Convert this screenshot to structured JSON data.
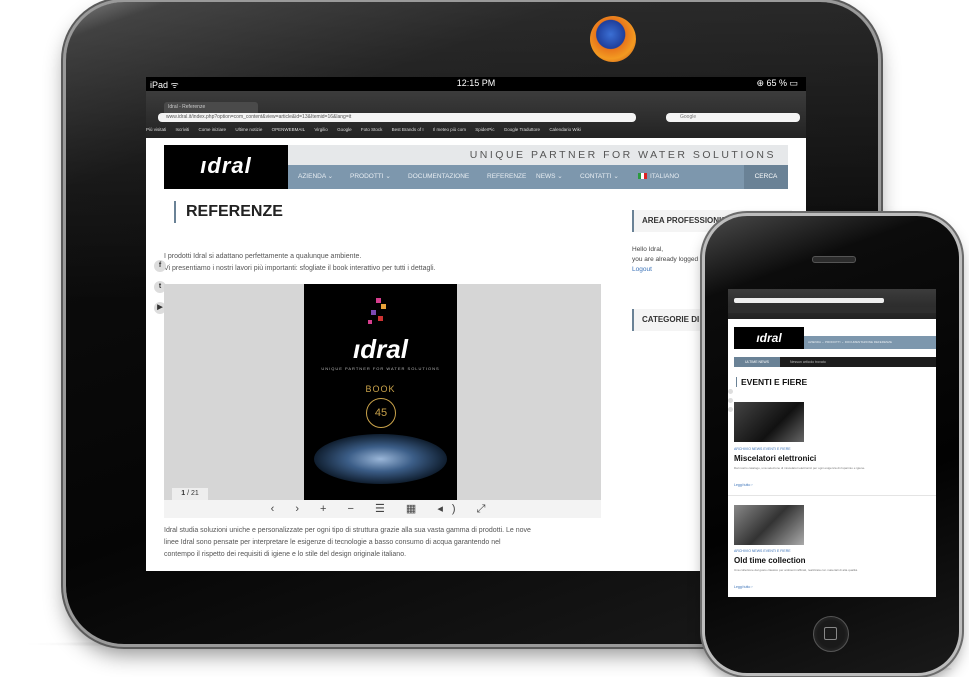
{
  "ipad": {
    "status_left": "iPad  ᯤ",
    "status_time": "12:15 PM",
    "status_battery": "⊕ 65 % ▭",
    "browser": {
      "tab_label": "Idral - Referenze",
      "url": "www.idral.it/index.php?option=com_content&view=article&id=13&Itemid=16&lang=it",
      "search_placeholder": "Google",
      "bookmarks": [
        "Più visitati",
        "Iscriviti",
        "Come iniziare",
        "Ultime notizie",
        "OPENWEBMAIL",
        "Virgilio",
        "Google",
        "Foto Stock",
        "Best Brands of I",
        "Il meteo più com",
        "SpiderPic",
        "Google Traduttore",
        "Calendario Wiki"
      ]
    },
    "site": {
      "logo": "ıdral",
      "tagline": "UNIQUE PARTNER FOR WATER SOLUTIONS",
      "nav": [
        "AZIENDA ⌄",
        "PRODOTTI ⌄",
        "DOCUMENTAZIONE",
        "REFERENZE",
        "NEWS ⌄",
        "CONTATTI ⌄",
        "ITALIANO"
      ],
      "nav_search": "CERCA",
      "page_title": "REFERENZE",
      "intro_line1": "I prodotti Idral si adattano perfettamente a qualunque ambiente.",
      "intro_line2": "Vi presentiamo i nostri lavori più importanti: sfogliate il book interattivo per tutti i dettagli.",
      "social": [
        "f",
        "t",
        "▶"
      ],
      "book": {
        "brand": "ıdral",
        "subtitle": "UNIQUE PARTNER FOR WATER SOLUTIONS",
        "label": "BOOK",
        "years": "45",
        "page_current": "1",
        "page_total": "/ 21"
      },
      "viewer_controls": "‹ › + − ☰ ▦ ◂) ⤢",
      "body_line1": "Idral studia soluzioni uniche e personalizzate per ogni tipo di struttura grazie alla sua vasta gamma di prodotti. Le nove",
      "body_line2": "linee Idral sono pensate per interpretare le esigenze di tecnologie a basso consumo di acqua garantendo nel",
      "body_line3": "contempo il rispetto dei requisiti di igiene e lo stile del design originale italiano.",
      "sidebar": {
        "area_title": "AREA PROFESSIONISTI",
        "hello": "Hello Idral,",
        "logged": "you are already logged in.",
        "logout": "Logout",
        "categories_title": "CATEGORIE DI"
      }
    }
  },
  "iphone": {
    "logo": "ıdral",
    "nav": "AZIENDA ⌄   PRODOTTI ⌄   DOCUMENTAZIONE   REFERENZE",
    "breadcrumb_tag": "ULTIME NEWS",
    "breadcrumb_text": "Nessun articolo trovato",
    "page_title": "EVENTI E FIERE",
    "articles": [
      {
        "category": "ARCHIVIO NEWS EVENTI E FIERE",
        "title": "Miscelatori elettronici",
        "text": "Dal nostro catalogo, una selezione di miscelatori elettronici per ogni esigenza di risparmio e igiene.",
        "more": "Leggi tutto ›"
      },
      {
        "category": "ARCHIVIO NEWS EVENTI E FIERE",
        "title": "Old time collection",
        "text": "Una collezione dal gusto classico per ambienti raffinati, realizzata con materiali di alta qualità.",
        "more": "Leggi tutto ›"
      }
    ]
  },
  "colors": {
    "nav_blue": "#7d97ad",
    "accent_blue": "#3a72b8",
    "device_black": "#050505"
  }
}
